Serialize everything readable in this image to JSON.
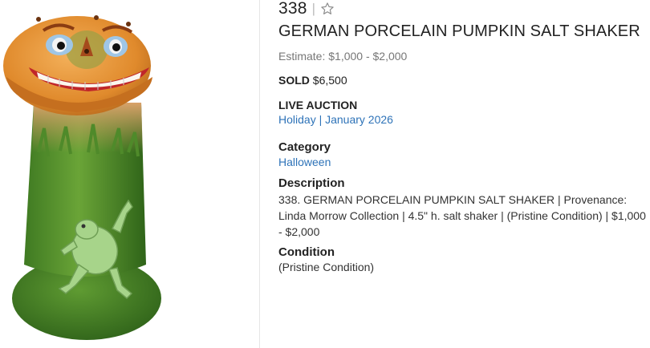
{
  "lot": {
    "number": "338",
    "separator": "|",
    "title": "GERMAN PORCELAIN PUMPKIN SALT SHAKER",
    "estimate": "Estimate: $1,000 - $2,000",
    "sold_label": "SOLD",
    "sold_price": "$6,500"
  },
  "auction": {
    "heading": "LIVE AUCTION",
    "link": "Holiday | January 2026"
  },
  "category": {
    "heading": "Category",
    "link": "Halloween"
  },
  "description": {
    "heading": "Description",
    "text": "338. GERMAN PORCELAIN PUMPKIN SALT SHAKER | Provenance: Linda Morrow Collection | 4.5\" h. salt shaker | (Pristine Condition) | $1,000 - $2,000"
  },
  "condition": {
    "heading": "Condition",
    "text": "(Pristine Condition)"
  },
  "icons": {
    "watch": "star-outline-icon"
  },
  "colors": {
    "link": "#2e73b8",
    "muted": "#777777"
  }
}
